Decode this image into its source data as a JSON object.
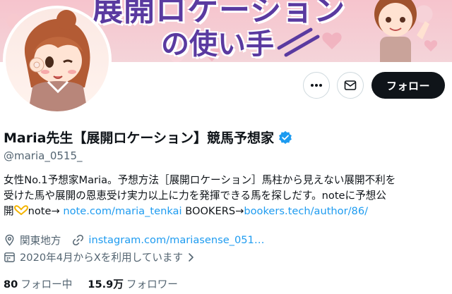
{
  "banner": {
    "title": "展開ロケーション",
    "subtitle": "の使い手"
  },
  "profile": {
    "name": "Maria先生【展開ロケーション】競馬予想家",
    "handle": "@maria_0515_",
    "verified": true,
    "bio_line1": "女性No.1予想家Maria。予想方法［展開ロケーション］馬柱から見えない展開不利を",
    "bio_line2": "受けた馬や展開の恩恵受け実力以上に力を発揮できる馬を探しだす。noteに予想公",
    "bio_line3_prefix": "開",
    "bio_line3_note": "note→ ",
    "bio_note_link": "note.com/maria_tenkai",
    "bio_bookers": " BOOKERS→",
    "bio_bookers_link": "bookers.tech/author/86/",
    "location": "関東地方",
    "website": "instagram.com/mariasense_051…",
    "joined": "2020年4月からXを利用しています",
    "following_count": "80",
    "following_label": "フォロー中",
    "followers_count": "15.9万",
    "followers_label": "フォロワー"
  },
  "actions": {
    "follow_label": "フォロー",
    "more_icon": "more-icon",
    "dm_icon": "mail-icon"
  },
  "colors": {
    "link": "#1d9bf0",
    "verified": "#1d9bf0",
    "follow_bg": "#0f1419",
    "muted": "#536471"
  }
}
